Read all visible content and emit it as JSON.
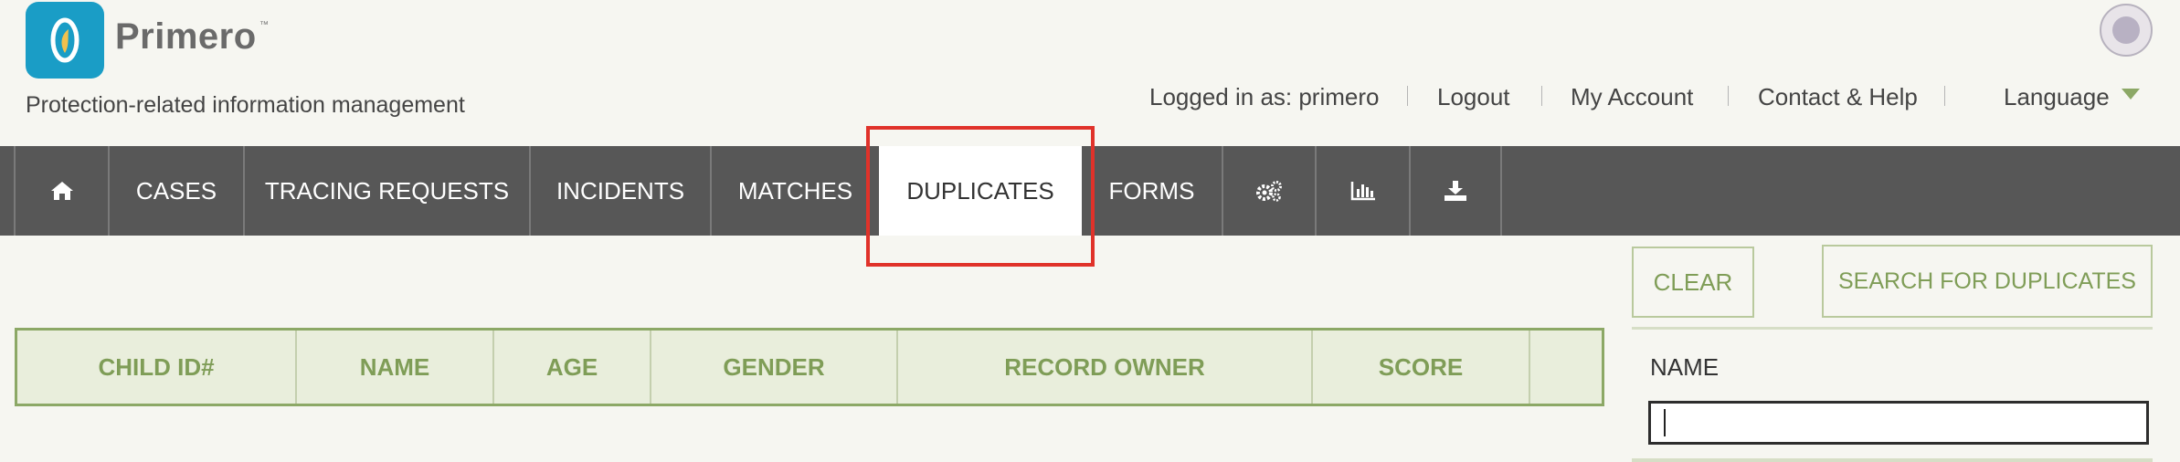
{
  "brand": {
    "name": "Primero",
    "trademark": "™",
    "tagline": "Protection-related information management"
  },
  "user_links": {
    "logged_in": "Logged in as: primero",
    "logout": "Logout",
    "my_account": "My Account",
    "contact_help": "Contact & Help",
    "language": "Language"
  },
  "nav": {
    "items": [
      {
        "label": "",
        "icon": "home-icon"
      },
      {
        "label": "CASES"
      },
      {
        "label": "TRACING REQUESTS"
      },
      {
        "label": "INCIDENTS"
      },
      {
        "label": "MATCHES"
      },
      {
        "label": "DUPLICATES",
        "active": true
      },
      {
        "label": "FORMS"
      },
      {
        "label": "",
        "icon": "gears-icon"
      },
      {
        "label": "",
        "icon": "bar-chart-icon"
      },
      {
        "label": "",
        "icon": "download-icon"
      }
    ]
  },
  "table": {
    "columns": [
      "CHILD ID#",
      "NAME",
      "AGE",
      "GENDER",
      "RECORD OWNER",
      "SCORE",
      ""
    ]
  },
  "panel": {
    "clear_label": "CLEAR",
    "search_label": "SEARCH FOR DUPLICATES",
    "name_label": "NAME",
    "name_value": ""
  },
  "colors": {
    "accent_green": "#7f9d57",
    "nav_background": "#575757",
    "highlight_red": "#e0322a",
    "logo_blue": "#1a9dc6"
  }
}
